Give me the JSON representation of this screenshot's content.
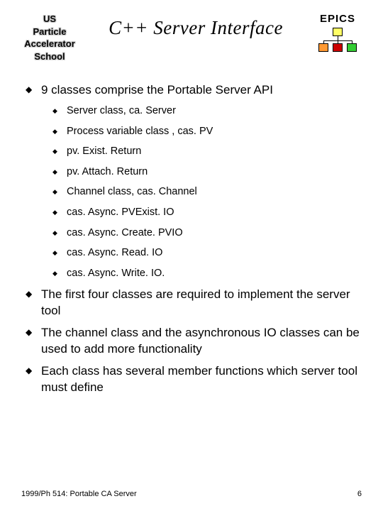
{
  "header": {
    "logo_left_lines": [
      "US",
      "Particle",
      "Accelerator",
      "School"
    ],
    "title": "C++ Server Interface",
    "epics_label": "EPICS"
  },
  "bullets": [
    {
      "text": "9 classes comprise the Portable Server API",
      "sub": [
        "Server class, ca. Server",
        "Process variable class , cas. PV",
        "pv. Exist. Return",
        "pv. Attach. Return",
        "Channel class, cas. Channel",
        "cas. Async. PVExist. IO",
        "cas. Async. Create. PVIO",
        "cas. Async. Read. IO",
        "cas. Async. Write. IO."
      ]
    },
    {
      "text": "The first four classes  are required to implement the server tool"
    },
    {
      "text": "The channel class and the asynchronous IO classes can be used to add more functionality"
    },
    {
      "text": "Each class has several member functions which server tool must define"
    }
  ],
  "footer": {
    "left": "1999/Ph 514: Portable CA Server",
    "page": "6"
  }
}
